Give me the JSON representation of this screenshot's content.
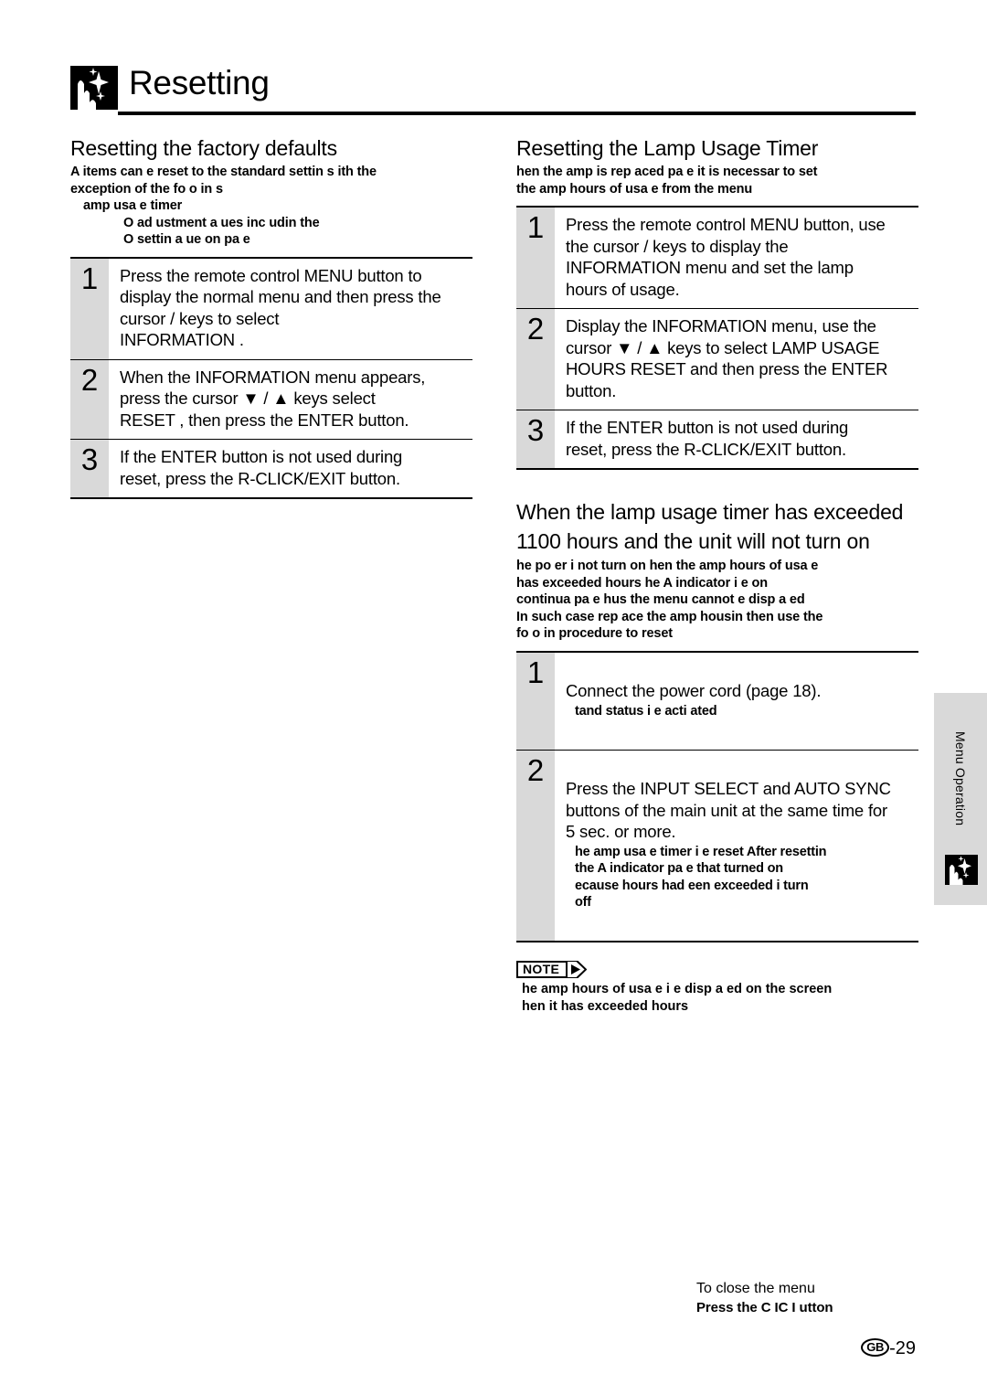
{
  "page": {
    "title": "Resetting",
    "header_icon": "sparkle-menu-icon",
    "number_prefix": "GB",
    "number": "-29"
  },
  "left_column": {
    "section": {
      "title": "Resetting the factory defaults",
      "intro": "A  items can  e reset to the standard settin s   ith the\nexception of the fo o  in s",
      "intro_item": " amp usa e timer",
      "intro_subitems": "O   ad ustment  a ues  inc udin  the\nO    settin   a ue on pa e"
    },
    "steps": [
      {
        "num": "1",
        "text": "Press the remote control MENU button to\ndisplay the normal menu and then press the\ncursor        /       keys to select\n INFORMATION  ."
      },
      {
        "num": "2",
        "text": "When the   INFORMATION   menu appears,\npress the cursor    ▼ / ▲ keys select\n RESET  , then press the ENTER button."
      },
      {
        "num": "3",
        "text": "If the ENTER button is not used during\nreset, press the R-CLICK/EXIT button."
      }
    ]
  },
  "right_column": {
    "section_lamp_timer": {
      "title": "Resetting the Lamp Usage Timer",
      "intro": "  hen the  amp is rep aced  pa e         it is necessar  to set\nthe  amp hours of usa e from the menu",
      "steps": [
        {
          "num": "1",
          "text": "Press the remote control MENU button, use\nthe cursor          /       keys to display the\n  INFORMATION    menu and set the lamp\nhours of usage."
        },
        {
          "num": "2",
          "text": "Display the   INFORMATION   menu, use the\ncursor  ▼ / ▲ keys to select    LAMP USAGE\nHOURS RESET   and then press the ENTER\nbutton."
        },
        {
          "num": "3",
          "text": "If the ENTER button is not used during\nreset, press the R-CLICK/EXIT button."
        }
      ]
    },
    "section_exceeded": {
      "title_line1": "When the lamp usage timer has exceeded",
      "title_line2": "1100 hours and the unit will not turn on",
      "intro": " he po  er  i   not turn on   hen the  amp hours of usa e\nhas exceeded           hours   he   A     indicator  i    e on\ncontinua      pa e          hus  the menu cannot  e disp a ed\nIn such case  rep ace the  amp housin    then use the\nfo o  in  procedure to reset",
      "steps": [
        {
          "num": "1",
          "text": "Connect the power cord (page 18).",
          "sub": " tand   status  i   e acti ated"
        },
        {
          "num": "2",
          "text": "Press the INPUT SELECT and AUTO SYNC\nbuttons of the main unit at the same time for\n5 sec. or more.",
          "sub": " he  amp usa e timer  i    e reset  After resettin\nthe    A      indicator  pa e        that turned on\n ecause        hours had  een exceeded   i  turn\noff"
        }
      ]
    },
    "note": {
      "badge": "NOTE",
      "text": " he  amp hours of usa e  i    e disp a ed on the screen\n hen it has exceeded        hours"
    }
  },
  "side_tab": {
    "label": "Menu Operation",
    "icon": "sparkle-menu-icon"
  },
  "footer": {
    "close_menu_line1": "To close the menu",
    "close_menu_line2": "Press the    C IC      I    utton"
  }
}
